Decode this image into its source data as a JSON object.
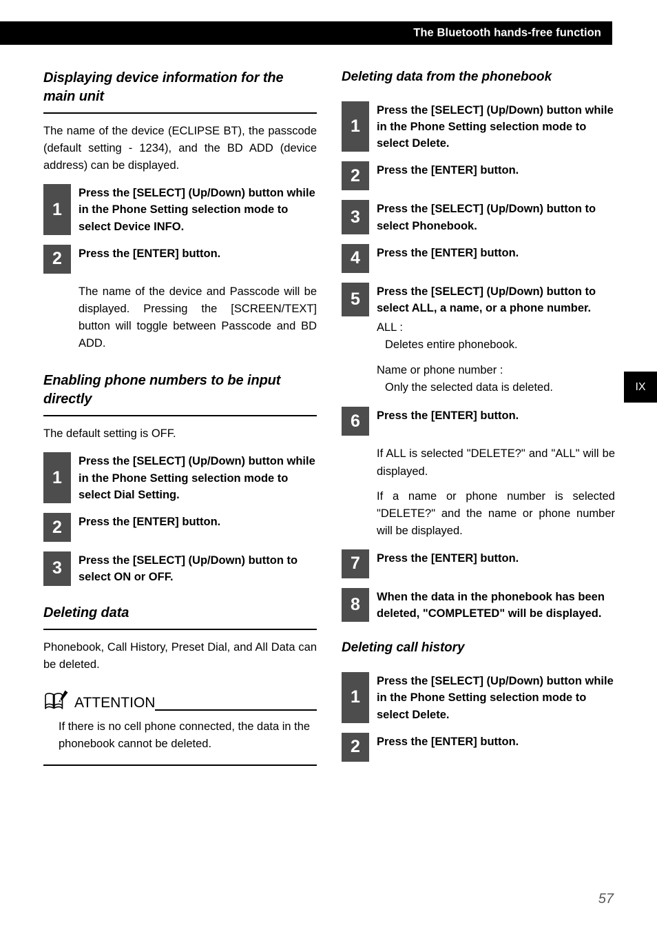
{
  "header": {
    "title": "The Bluetooth hands-free function"
  },
  "side_tab": {
    "label": "IX"
  },
  "folio": {
    "page_number": "57"
  },
  "left_column": {
    "section1": {
      "heading": "Displaying device information for the main unit",
      "intro": "The name of the device (ECLIPSE BT), the passcode (default setting - 1234), and the BD ADD (device address) can be displayed.",
      "steps": [
        {
          "number": "1",
          "text": "Press the [SELECT] (Up/Down) button while in the Phone Setting selection mode to select Device INFO."
        },
        {
          "number": "2",
          "text": "Press the [ENTER] button."
        }
      ],
      "note": "The name of the device and Passcode will be displayed. Pressing the [SCREEN/TEXT] button will toggle between Passcode and BD ADD."
    },
    "section2": {
      "heading": "Enabling phone numbers to be input directly",
      "intro": "The default setting is OFF.",
      "steps": [
        {
          "number": "1",
          "text": "Press the [SELECT] (Up/Down) button while in the Phone Setting selection mode to select Dial Setting."
        },
        {
          "number": "2",
          "text": "Press the [ENTER] button."
        },
        {
          "number": "3",
          "text": "Press the [SELECT] (Up/Down) button to select ON or OFF."
        }
      ]
    },
    "section3": {
      "heading": "Deleting data",
      "intro": "Phonebook, Call History, Preset Dial, and All Data can be deleted.",
      "attention": {
        "icon": "book-attention-icon",
        "label": "ATTENTION",
        "text": "If there is no cell phone connected, the data in the phonebook cannot be deleted."
      }
    }
  },
  "right_column": {
    "section1": {
      "heading": "Deleting data from the phonebook",
      "steps": [
        {
          "number": "1",
          "text": "Press the [SELECT] (Up/Down) button while in the Phone Setting selection mode to select Delete."
        },
        {
          "number": "2",
          "text": "Press the [ENTER] button."
        },
        {
          "number": "3",
          "text": "Press the [SELECT] (Up/Down) button to select Phonebook."
        },
        {
          "number": "4",
          "text": "Press the [ENTER] button."
        },
        {
          "number": "5",
          "text": "Press the [SELECT] (Up/Down) button to select ALL, a name, or a phone number."
        },
        {
          "number": "6",
          "text": "Press the [ENTER] button."
        },
        {
          "number": "7",
          "text": "Press the [ENTER] button."
        },
        {
          "number": "8",
          "text": "When the data in the phonebook has been deleted, \"COMPLETED\" will be displayed."
        }
      ],
      "note_all_label": "ALL :",
      "note_all_text": "Deletes entire phonebook.",
      "note_name_label": "Name or phone number :",
      "note_name_text": "Only the selected data is deleted.",
      "note_step6_a": "If ALL is selected \"DELETE?\" and \"ALL\" will be displayed.",
      "note_step6_b": "If a name or phone number is selected \"DELETE?\" and the name or phone number will be displayed."
    },
    "section2": {
      "heading": "Deleting call history",
      "steps": [
        {
          "number": "1",
          "text": "Press the [SELECT] (Up/Down) button while in the Phone Setting selection mode to select Delete."
        },
        {
          "number": "2",
          "text": "Press the [ENTER] button."
        }
      ]
    }
  },
  "colors": {
    "header_bar": "#000000",
    "step_badge": "#4d4d4d",
    "text": "#000000",
    "folio": "#595959"
  }
}
